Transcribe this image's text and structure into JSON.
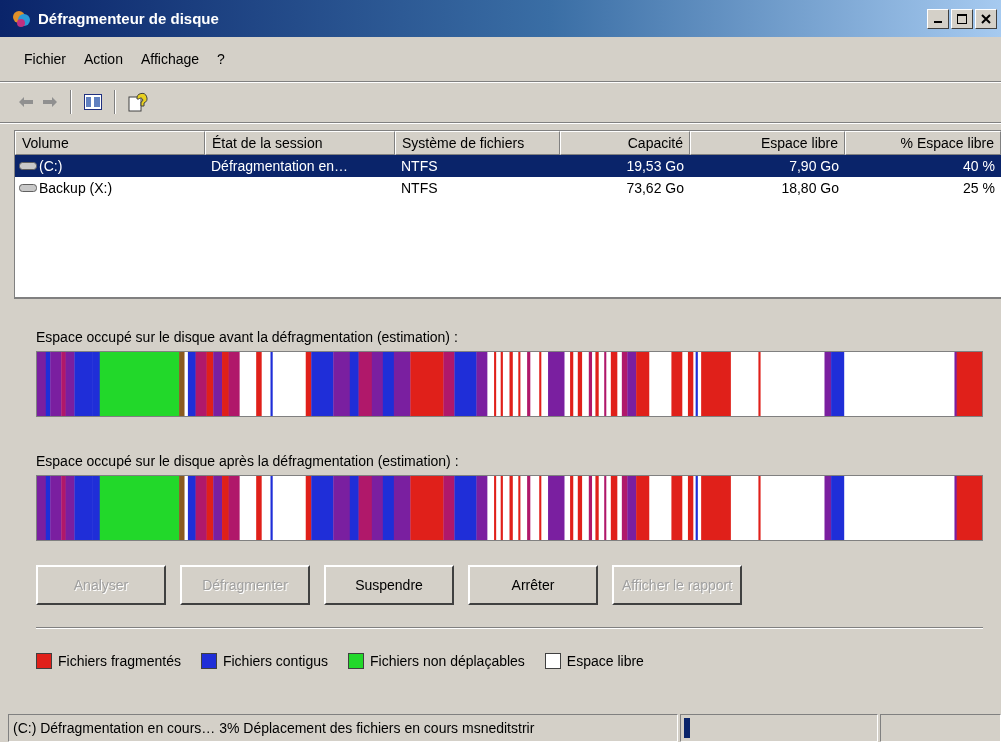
{
  "window": {
    "title": "Défragmenteur de disque"
  },
  "menu": [
    {
      "label": "Fichier"
    },
    {
      "label": "Action"
    },
    {
      "label": "Affichage"
    },
    {
      "label": "?"
    }
  ],
  "volumes": {
    "columns": [
      {
        "label": "Volume"
      },
      {
        "label": "État de la session"
      },
      {
        "label": "Système de fichiers"
      },
      {
        "label": "Capacité"
      },
      {
        "label": "Espace libre"
      },
      {
        "label": "% Espace libre"
      }
    ],
    "rows": [
      {
        "volume": "(C:)",
        "session_state": "Défragmentation en…",
        "file_system": "NTFS",
        "capacity": "19,53 Go",
        "free_space": "7,90 Go",
        "free_percent": "40 %",
        "selected": true
      },
      {
        "volume": "Backup (X:)",
        "session_state": "",
        "file_system": "NTFS",
        "capacity": "73,62 Go",
        "free_space": "18,80 Go",
        "free_percent": "25 %",
        "selected": false
      }
    ]
  },
  "maps": [
    {
      "label": "Espace occupé sur le disque avant la défragmentation (estimation) :"
    },
    {
      "label": "Espace occupé sur le disque après la défragmentation (estimation) :"
    }
  ],
  "buttons": [
    {
      "label": "Analyser",
      "disabled": true
    },
    {
      "label": "Défragmenter",
      "disabled": true
    },
    {
      "label": "Suspendre",
      "disabled": false
    },
    {
      "label": "Arrêter",
      "disabled": false
    },
    {
      "label": "Afficher le rapport",
      "disabled": true
    }
  ],
  "legend": [
    {
      "label": "Fichiers fragmentés",
      "color": "#e0201a"
    },
    {
      "label": "Fichiers contigus",
      "color": "#1f2ed8"
    },
    {
      "label": "Fichiers non déplaçables",
      "color": "#22d82a"
    },
    {
      "label": "Espace libre",
      "color": "#ffffff"
    }
  ],
  "status_bar": {
    "text": "(C:) Défragmentation en cours… 3% Déplacement des fichiers en cours msneditstrir",
    "level": 0.03
  }
}
